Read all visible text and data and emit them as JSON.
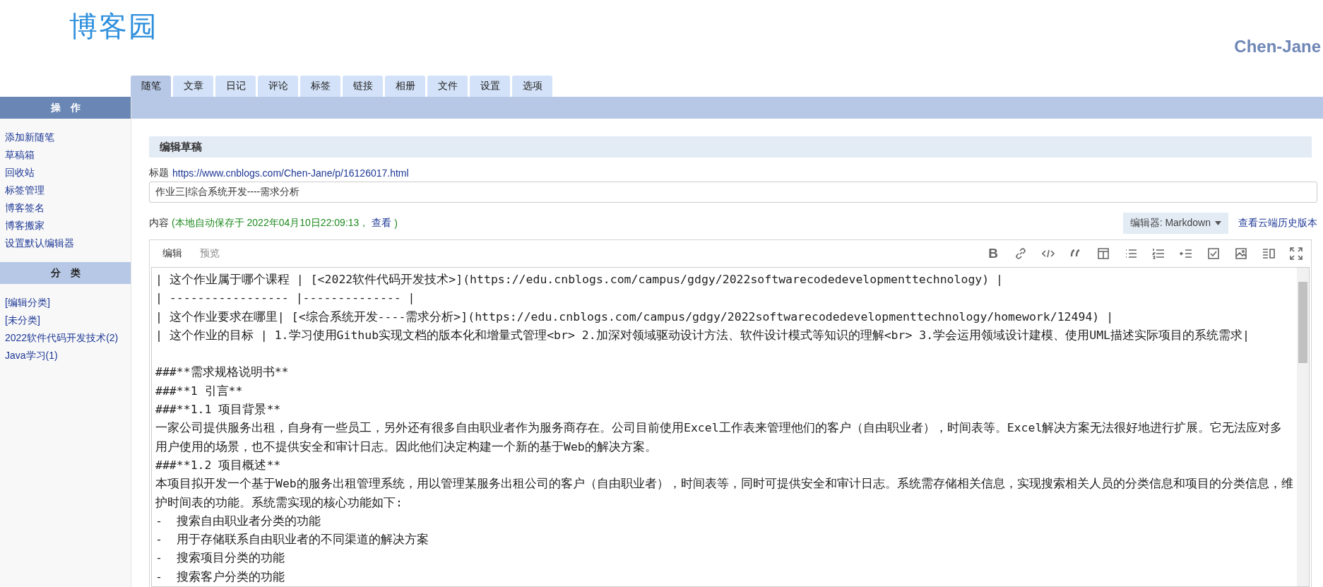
{
  "header": {
    "logo": "博客园",
    "user": "Chen-Jane"
  },
  "tabs": [
    {
      "label": "随笔",
      "selected": true
    },
    {
      "label": "文章",
      "selected": false
    },
    {
      "label": "日记",
      "selected": false
    },
    {
      "label": "评论",
      "selected": false
    },
    {
      "label": "标签",
      "selected": false
    },
    {
      "label": "链接",
      "selected": false
    },
    {
      "label": "相册",
      "selected": false
    },
    {
      "label": "文件",
      "selected": false
    },
    {
      "label": "设置",
      "selected": false
    },
    {
      "label": "选项",
      "selected": false
    }
  ],
  "sidebar": {
    "sections": [
      {
        "title": "操　作",
        "kind": "primary",
        "items": [
          "添加新随笔",
          "草稿箱",
          "回收站",
          "标签管理",
          "博客签名",
          "博客搬家",
          "设置默认编辑器"
        ]
      },
      {
        "title": "分　类",
        "kind": "secondary",
        "items": [
          "[编辑分类]",
          "[未分类]",
          "2022软件代码开发技术(2)",
          "Java学习(1)"
        ]
      }
    ]
  },
  "form": {
    "heading": "编辑草稿",
    "title_label": "标题",
    "title_link": "https://www.cnblogs.com/Chen-Jane/p/16126017.html",
    "title_value": "作业三|综合系统开发----需求分析",
    "content_label": "内容",
    "autosave_text": "(本地自动保存于 2022年04月10日22:09:13，",
    "autosave_link": "查看",
    "autosave_close": ")",
    "editor_select": "编辑器: Markdown",
    "history_link": "查看云端历史版本"
  },
  "editor": {
    "modes": [
      {
        "label": "编辑",
        "selected": true
      },
      {
        "label": "预览",
        "selected": false
      }
    ],
    "bold_button": "B",
    "blocks": [
      {
        "lines": [
          "| 这个作业属于哪个课程 | [<2022软件代码开发技术>](https://edu.cnblogs.com/campus/gdgy/2022softwarecodedevelopmenttechnology) |",
          "| ----------------- |-------------- |",
          "| 这个作业要求在哪里| [<综合系统开发----需求分析>](https://edu.cnblogs.com/campus/gdgy/2022softwarecodedevelopmenttechnology/homework/12494) |",
          "| 这个作业的目标 | 1.学习使用Github实现文档的版本化和增量式管理<br> 2.加深对领域驱动设计方法、软件设计模式等知识的理解<br> 3.学会运用领域设计建模、使用UML描述实际项目的系统需求|"
        ]
      },
      {
        "lines": [
          "###**需求规格说明书**",
          "###**1 引言**",
          "###**1.1 项目背景**",
          "一家公司提供服务出租，自身有一些员工，另外还有很多自由职业者作为服务商存在。公司目前使用Excel工作表来管理他们的客户（自由职业者），时间表等。Excel解决方案无法很好地进行扩展。它无法应对多用户使用的场景，也不提供安全和审计日志。因此他们决定构建一个新的基于Web的解决方案。",
          "###**1.2 项目概述**",
          "本项目拟开发一个基于Web的服务出租管理系统，用以管理某服务出租公司的客户（自由职业者），时间表等，同时可提供安全和审计日志。系统需存储相关信息，实现搜索相关人员的分类信息和项目的分类信息，维护时间表的功能。系统需实现的核心功能如下:",
          "-  搜索自由职业者分类的功能",
          "-  用于存储联系自由职业者的不同渠道的解决方案",
          "-  搜索项目分类的功能",
          "-  搜索客户分类的功能"
        ]
      }
    ]
  }
}
